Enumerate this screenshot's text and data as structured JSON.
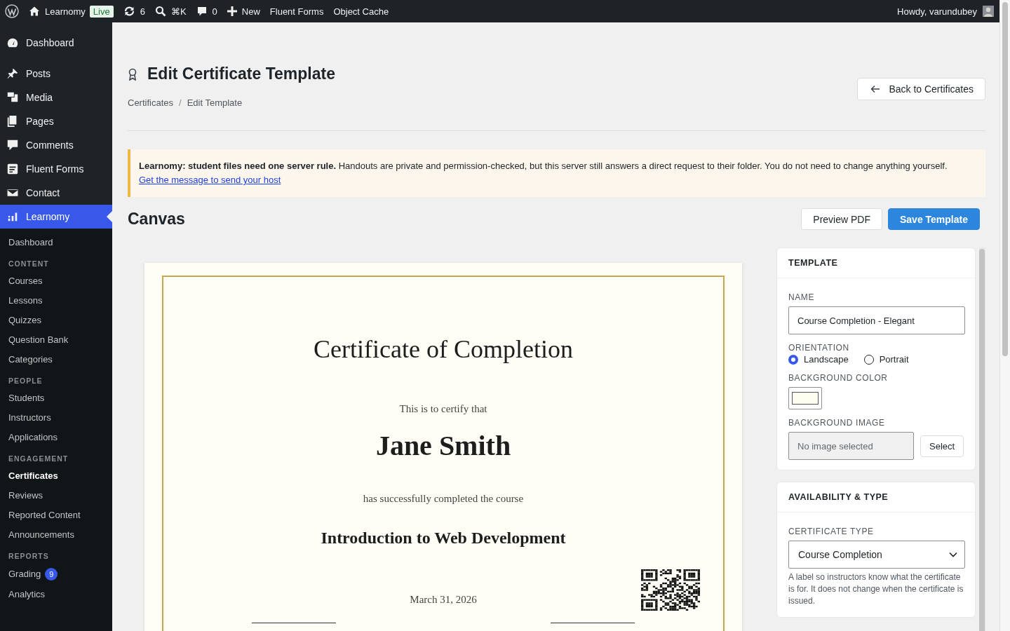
{
  "admin_bar": {
    "site": "Learnomy",
    "env_badge": "Live",
    "updates": "6",
    "search_shortcut": "⌘K",
    "comments": "0",
    "new": "New",
    "links": [
      "Fluent Forms",
      "Object Cache"
    ],
    "greeting": "Howdy, varundubey"
  },
  "sidebar": {
    "menu": [
      {
        "label": "Dashboard",
        "selected": false
      },
      {
        "label": "Posts",
        "selected": false
      },
      {
        "label": "Media",
        "selected": false
      },
      {
        "label": "Pages",
        "selected": false
      },
      {
        "label": "Comments",
        "selected": false
      },
      {
        "label": "Fluent Forms",
        "selected": false
      },
      {
        "label": "Contact",
        "selected": false
      },
      {
        "label": "Learnomy",
        "selected": true
      }
    ],
    "submenu_top": [
      {
        "label": "Dashboard",
        "selected": false
      }
    ],
    "groups": [
      {
        "heading": "CONTENT",
        "items": [
          {
            "label": "Courses",
            "selected": false
          },
          {
            "label": "Lessons",
            "selected": false
          },
          {
            "label": "Quizzes",
            "selected": false
          },
          {
            "label": "Question Bank",
            "selected": false
          },
          {
            "label": "Categories",
            "selected": false
          }
        ]
      },
      {
        "heading": "PEOPLE",
        "items": [
          {
            "label": "Students",
            "selected": false
          },
          {
            "label": "Instructors",
            "selected": false
          },
          {
            "label": "Applications",
            "selected": false
          }
        ]
      },
      {
        "heading": "ENGAGEMENT",
        "items": [
          {
            "label": "Certificates",
            "selected": true
          },
          {
            "label": "Reviews",
            "selected": false
          },
          {
            "label": "Reported Content",
            "selected": false
          },
          {
            "label": "Announcements",
            "selected": false
          }
        ]
      },
      {
        "heading": "REPORTS",
        "items": [
          {
            "label": "Grading",
            "selected": false,
            "badge": "9"
          },
          {
            "label": "Analytics",
            "selected": false
          }
        ]
      }
    ]
  },
  "page": {
    "title": "Edit Certificate Template",
    "breadcrumbs": [
      "Certificates",
      "Edit Template"
    ],
    "breadcrumb_separator": "/",
    "back_button": "Back to Certificates"
  },
  "notice": {
    "text": "**Learnomy: student files need one server rule.** Handouts are private and permission-checked, but this server still answers a direct request to their folder. You do not need to change anything yourself.",
    "link": "Get the message to send your host"
  },
  "canvas": {
    "heading": "Canvas",
    "buttons": [
      {
        "label": "Preview PDF",
        "kind": "secondary"
      },
      {
        "label": "Save Template",
        "kind": "primary"
      }
    ]
  },
  "certificate": {
    "title": "Certificate of Completion",
    "intro": "This is to certify that",
    "recipient": "Jane Smith",
    "completed_text": "has successfully completed the course",
    "course": "Introduction to Web Development",
    "date": "March 31, 2026"
  },
  "panel": {
    "template": {
      "heading": "TEMPLATE",
      "name_label": "NAME",
      "name_value": "Course Completion - Elegant",
      "orientation_label": "ORIENTATION",
      "orientations": [
        {
          "label": "Landscape",
          "selected": true
        },
        {
          "label": "Portrait",
          "selected": false
        }
      ],
      "background_color_label": "BACKGROUND COLOR",
      "background_image_label": "BACKGROUND IMAGE",
      "background_image_placeholder": "No image selected",
      "select_button": "Select"
    },
    "availability": {
      "heading": "AVAILABILITY & TYPE",
      "type_label": "CERTIFICATE TYPE",
      "type_value": "Course Completion",
      "help": "A label so instructors know what the certificate is for. It does not change when the certificate is issued."
    }
  }
}
